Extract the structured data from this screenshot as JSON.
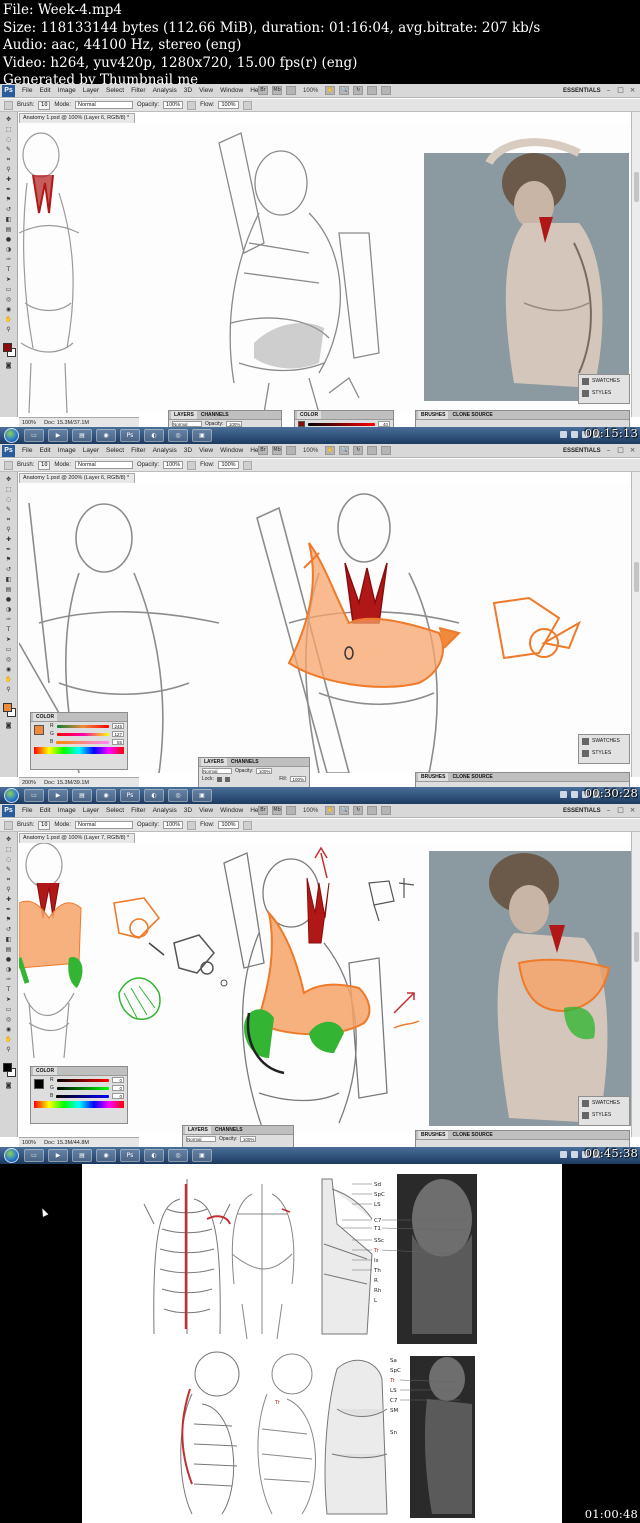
{
  "info": {
    "line1": "File: Week-4.mp4",
    "line2": "Size: 118133144 bytes (112.66 MiB), duration: 01:16:04, avg.bitrate: 207 kb/s",
    "line3": "Audio: aac, 44100 Hz, stereo (eng)",
    "line4": "Video: h264, yuv420p, 1280x720, 15.00 fps(r) (eng)",
    "line5": "Generated by Thumbnail me"
  },
  "menus": [
    "File",
    "Edit",
    "Image",
    "Layer",
    "Select",
    "Filter",
    "Analysis",
    "3D",
    "View",
    "Window",
    "Help"
  ],
  "toolbar": {
    "zoom": "100%",
    "essentials": "ESSENTIALS",
    "brush_label": "Brush:",
    "brush_size": "10",
    "mode_label": "Mode:",
    "mode_value": "Normal",
    "opacity_label": "Opacity:",
    "opacity_value": "100%",
    "flow_label": "Flow:",
    "flow_value": "100%"
  },
  "frames": [
    {
      "timestamp": "00:15:13",
      "doc_tab": "Anatomy 1.psd @ 100% (Layer 6, RGB/8) *",
      "zoom_status": "100%",
      "doc_status": "Doc: 15.3M/37.1M",
      "fg_color": "#8b0a0a",
      "layers_tab": "LAYERS",
      "channels_tab": "CHANNELS",
      "color_tab": "COLOR",
      "color_value": "40",
      "brushes_tab": "BRUSHES",
      "clone_tab": "CLONE SOURCE",
      "swatches": "SWATCHES",
      "styles": "STYLES",
      "layer_mode": "Normal",
      "layer_opacity_label": "Opacity:",
      "layer_opacity": "100%"
    },
    {
      "timestamp": "00:30:28",
      "doc_tab": "Anatomy 1.psd @ 200% (Layer 6, RGB/8) *",
      "zoom_status": "200%",
      "doc_status": "Doc: 15.3M/39.1M",
      "fg_color": "#f08a3a",
      "color_tab": "COLOR",
      "r_value": "245",
      "g_value": "127",
      "b_value": "55",
      "layers_tab": "LAYERS",
      "channels_tab": "CHANNELS",
      "brushes_tab": "BRUSHES",
      "clone_tab": "CLONE SOURCE",
      "swatches": "SWATCHES",
      "styles": "STYLES",
      "layer_mode": "Normal",
      "layer_opacity_label": "Opacity:",
      "layer_opacity": "100%",
      "lock_label": "Lock:",
      "fill_label": "Fill:",
      "fill_value": "100%"
    },
    {
      "timestamp": "00:45:38",
      "doc_tab": "Anatomy 1.psd @ 100% (Layer 7, RGB/8) *",
      "zoom_status": "100%",
      "doc_status": "Doc: 15.3M/44.8M",
      "fg_color": "#000000",
      "color_tab": "COLOR",
      "r_value": "0",
      "g_value": "0",
      "b_value": "0",
      "layers_tab": "LAYERS",
      "channels_tab": "CHANNELS",
      "brushes_tab": "BRUSHES",
      "clone_tab": "CLONE SOURCE",
      "swatches": "SWATCHES",
      "styles": "STYLES",
      "layer_mode": "Normal",
      "layer_opacity_label": "Opacity:",
      "layer_opacity": "100%"
    },
    {
      "timestamp": "01:00:48",
      "labels_top": [
        "Sd",
        "SpC",
        "LS",
        "C7",
        "T1",
        "SSc",
        "Tr",
        "Is",
        "Th",
        "R",
        "Rh",
        "L"
      ],
      "labels_bottom": [
        "Sa",
        "SpC",
        "Tr",
        "LS",
        "C7",
        "SM",
        "Sn"
      ],
      "label_tr": "Tr"
    }
  ],
  "colors": {
    "muscle_red": "#b01818",
    "muscle_orange": "#f08a3a",
    "muscle_green": "#33b533",
    "photo_bg": "#8a9aa0"
  }
}
